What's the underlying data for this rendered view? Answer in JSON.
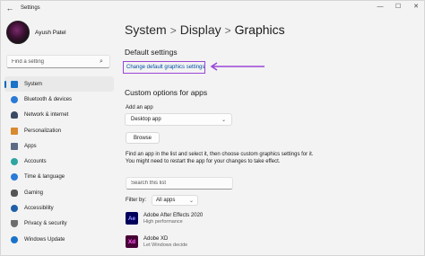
{
  "window": {
    "title": "Settings",
    "controls": [
      "—",
      "☐",
      "✕"
    ]
  },
  "user": {
    "name": "Ayush Patel"
  },
  "search": {
    "placeholder": "Find a setting"
  },
  "nav": {
    "items": [
      {
        "label": "System",
        "icon": "monitor-icon",
        "color": "#1a73c9",
        "active": true
      },
      {
        "label": "Bluetooth & devices",
        "icon": "bluetooth-icon",
        "color": "#2a7ad6"
      },
      {
        "label": "Network & internet",
        "icon": "wifi-icon",
        "color": "#3a4a63"
      },
      {
        "label": "Personalization",
        "icon": "brush-icon",
        "color": "#d88a2e"
      },
      {
        "label": "Apps",
        "icon": "apps-icon",
        "color": "#5b6b86"
      },
      {
        "label": "Accounts",
        "icon": "person-icon",
        "color": "#2fa4a0"
      },
      {
        "label": "Time & language",
        "icon": "globe-clock-icon",
        "color": "#2a7ad6"
      },
      {
        "label": "Gaming",
        "icon": "controller-icon",
        "color": "#555555"
      },
      {
        "label": "Accessibility",
        "icon": "accessibility-icon",
        "color": "#1f5fa8"
      },
      {
        "label": "Privacy & security",
        "icon": "shield-icon",
        "color": "#6e6e6e"
      },
      {
        "label": "Windows Update",
        "icon": "update-icon",
        "color": "#1a73c9"
      }
    ]
  },
  "breadcrumb": {
    "level1": "System",
    "level2": "Display",
    "current": "Graphics",
    "separator": ">"
  },
  "default_settings": {
    "title": "Default settings",
    "link": "Change default graphics settings",
    "highlight_color": "#9b45d6"
  },
  "custom": {
    "title": "Custom options for apps",
    "add_label": "Add an app",
    "dropdown_value": "Desktop app",
    "browse_label": "Browse",
    "info": "Find an app in the list and select it, then choose custom graphics settings for it. You might need to restart the app for your changes to take effect.",
    "list_search_placeholder": "Search this list",
    "filter_label": "Filter by:",
    "filter_value": "All apps"
  },
  "apps": [
    {
      "name": "Adobe After Effects 2020",
      "sub": "High performance",
      "badge": "Ae",
      "bg": "#00005b",
      "fg": "#9999ff"
    },
    {
      "name": "Adobe XD",
      "sub": "Let Windows decide",
      "badge": "Xd",
      "bg": "#470137",
      "fg": "#ff61f6"
    }
  ]
}
